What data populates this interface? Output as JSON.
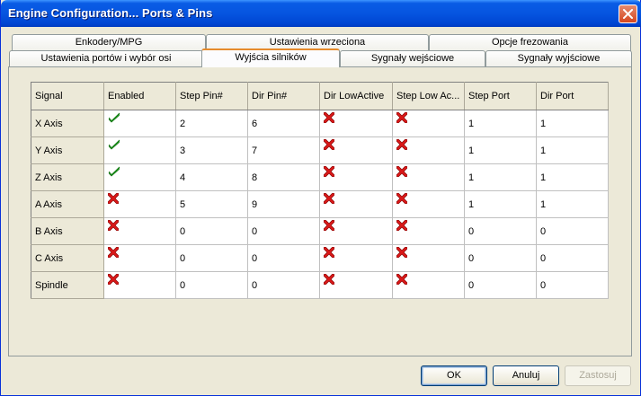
{
  "window": {
    "title": "Engine Configuration... Ports & Pins"
  },
  "tabs": {
    "row_back": [
      {
        "label": "Enkodery/MPG"
      },
      {
        "label": "Ustawienia wrzeciona"
      },
      {
        "label": "Opcje frezowania"
      }
    ],
    "row_front": [
      {
        "label": "Ustawienia portów i wybór osi"
      },
      {
        "label": "Wyjścia silników"
      },
      {
        "label": "Sygnały wejściowe"
      },
      {
        "label": "Sygnały wyjściowe"
      }
    ],
    "active": "Wyjścia silników"
  },
  "grid": {
    "columns": [
      "Signal",
      "Enabled",
      "Step Pin#",
      "Dir Pin#",
      "Dir LowActive",
      "Step Low Ac...",
      "Step Port",
      "Dir Port"
    ],
    "rows": [
      {
        "signal": "X Axis",
        "enabled": "check",
        "step_pin": "2",
        "dir_pin": "6",
        "dir_low": "cross",
        "step_low": "cross",
        "step_port": "1",
        "dir_port": "1"
      },
      {
        "signal": "Y Axis",
        "enabled": "check",
        "step_pin": "3",
        "dir_pin": "7",
        "dir_low": "cross",
        "step_low": "cross",
        "step_port": "1",
        "dir_port": "1"
      },
      {
        "signal": "Z Axis",
        "enabled": "check",
        "step_pin": "4",
        "dir_pin": "8",
        "dir_low": "cross",
        "step_low": "cross",
        "step_port": "1",
        "dir_port": "1"
      },
      {
        "signal": "A Axis",
        "enabled": "cross",
        "step_pin": "5",
        "dir_pin": "9",
        "dir_low": "cross",
        "step_low": "cross",
        "step_port": "1",
        "dir_port": "1"
      },
      {
        "signal": "B Axis",
        "enabled": "cross",
        "step_pin": "0",
        "dir_pin": "0",
        "dir_low": "cross",
        "step_low": "cross",
        "step_port": "0",
        "dir_port": "0"
      },
      {
        "signal": "C Axis",
        "enabled": "cross",
        "step_pin": "0",
        "dir_pin": "0",
        "dir_low": "cross",
        "step_low": "cross",
        "step_port": "0",
        "dir_port": "0"
      },
      {
        "signal": "Spindle",
        "enabled": "cross",
        "step_pin": "0",
        "dir_pin": "0",
        "dir_low": "cross",
        "step_low": "cross",
        "step_port": "0",
        "dir_port": "0"
      }
    ]
  },
  "buttons": {
    "ok": "OK",
    "cancel": "Anuluj",
    "apply": "Zastosuj"
  },
  "colors": {
    "check": "#22b022",
    "cross": "#d81818",
    "title_bar": "#0055e5",
    "active_tab_accent": "#e68b2c"
  }
}
